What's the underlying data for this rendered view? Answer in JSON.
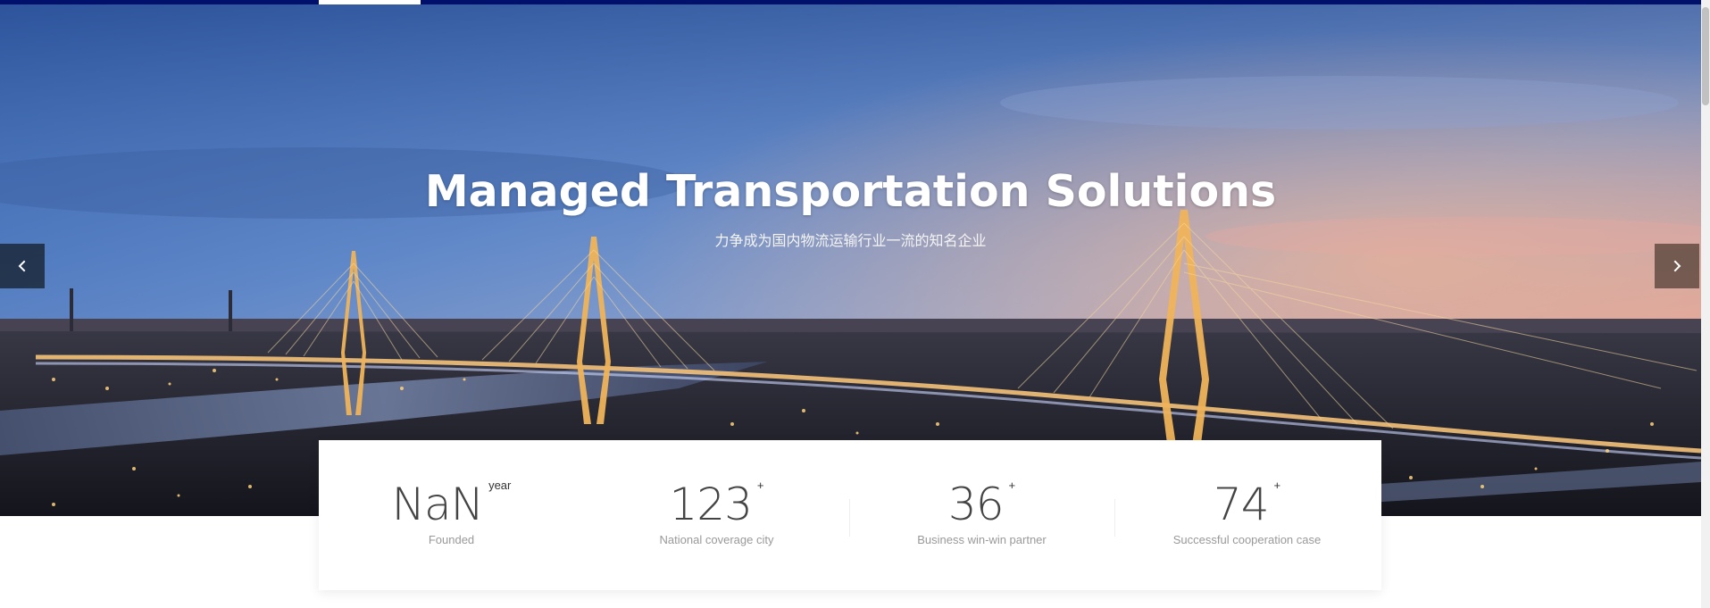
{
  "hero": {
    "title": "Managed Transportation Solutions",
    "subtitle": "力争成为国内物流运输行业一流的知名企业"
  },
  "slider": {
    "prev_icon": "chevron-left-icon",
    "next_icon": "chevron-right-icon"
  },
  "stats": [
    {
      "number": "NaN",
      "suffix": "year",
      "label": "Founded"
    },
    {
      "number": "123",
      "suffix": "+",
      "label": "National coverage city"
    },
    {
      "number": "36",
      "suffix": "+",
      "label": "Business win-win partner"
    },
    {
      "number": "74",
      "suffix": "+",
      "label": "Successful cooperation case"
    }
  ],
  "colors": {
    "top_bar": "#00106b",
    "stat_number": "#444444",
    "stat_label": "#999999",
    "hero_title": "#ffffff"
  }
}
